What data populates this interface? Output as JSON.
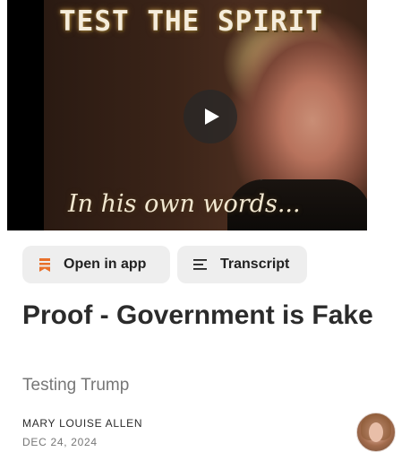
{
  "video": {
    "title_overlay": "TEST THE SPIRIT",
    "caption_overlay": "In his own words...",
    "play_icon": "play-icon"
  },
  "actions": {
    "open_in_app": {
      "label": "Open in app",
      "icon": "bookmark-icon",
      "icon_color": "#E8702A"
    },
    "transcript": {
      "label": "Transcript",
      "icon": "menu-lines-icon"
    }
  },
  "post": {
    "title": "Proof - Government is Fake",
    "subtitle": "Testing Trump",
    "author": "MARY LOUISE ALLEN",
    "date": "DEC 24, 2024"
  }
}
